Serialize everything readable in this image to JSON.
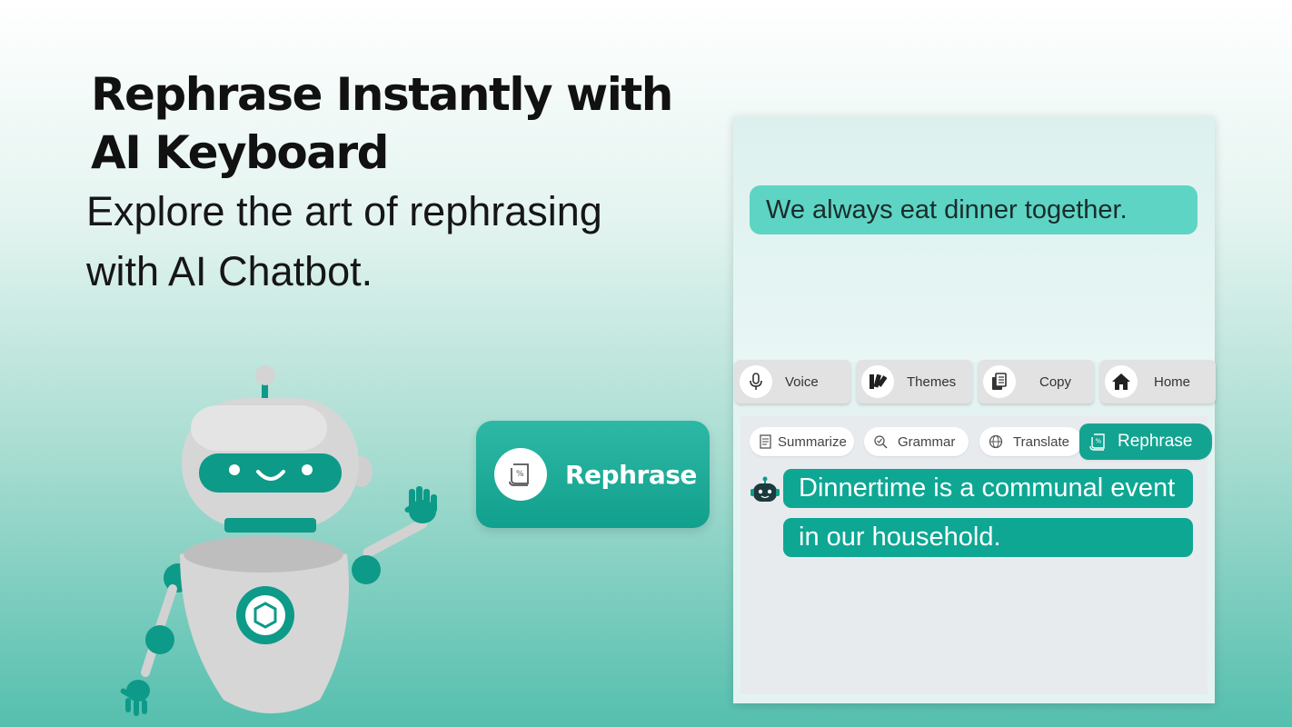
{
  "hero": {
    "title_line1": "Rephrase Instantly with",
    "title_line2": "AI Keyboard",
    "subtitle_line1": "Explore the art of rephrasing",
    "subtitle_line2": "with AI Chatbot."
  },
  "feature_button": {
    "label": "Rephrase",
    "icon": "rephrase-scroll-icon"
  },
  "phone": {
    "input_text": "We always eat dinner together.",
    "toolbar": [
      {
        "label": "Voice",
        "icon": "microphone-icon"
      },
      {
        "label": "Themes",
        "icon": "palette-icon"
      },
      {
        "label": "Copy",
        "icon": "copy-icon"
      },
      {
        "label": "Home",
        "icon": "home-icon"
      }
    ],
    "chips": [
      {
        "label": "Summarize",
        "icon": "summarize-icon"
      },
      {
        "label": "Grammar",
        "icon": "grammar-icon"
      },
      {
        "label": "Translate",
        "icon": "translate-icon"
      },
      {
        "label": "Rephrase",
        "icon": "rephrase-scroll-icon",
        "active": true
      }
    ],
    "reply_lines": [
      "Dinnertime is a communal event",
      "in our household."
    ]
  },
  "colors": {
    "accent": "#13a491",
    "accent_light": "#5ed4c5",
    "robot_body": "#d9d9d9",
    "robot_teal": "#0e9a88"
  }
}
